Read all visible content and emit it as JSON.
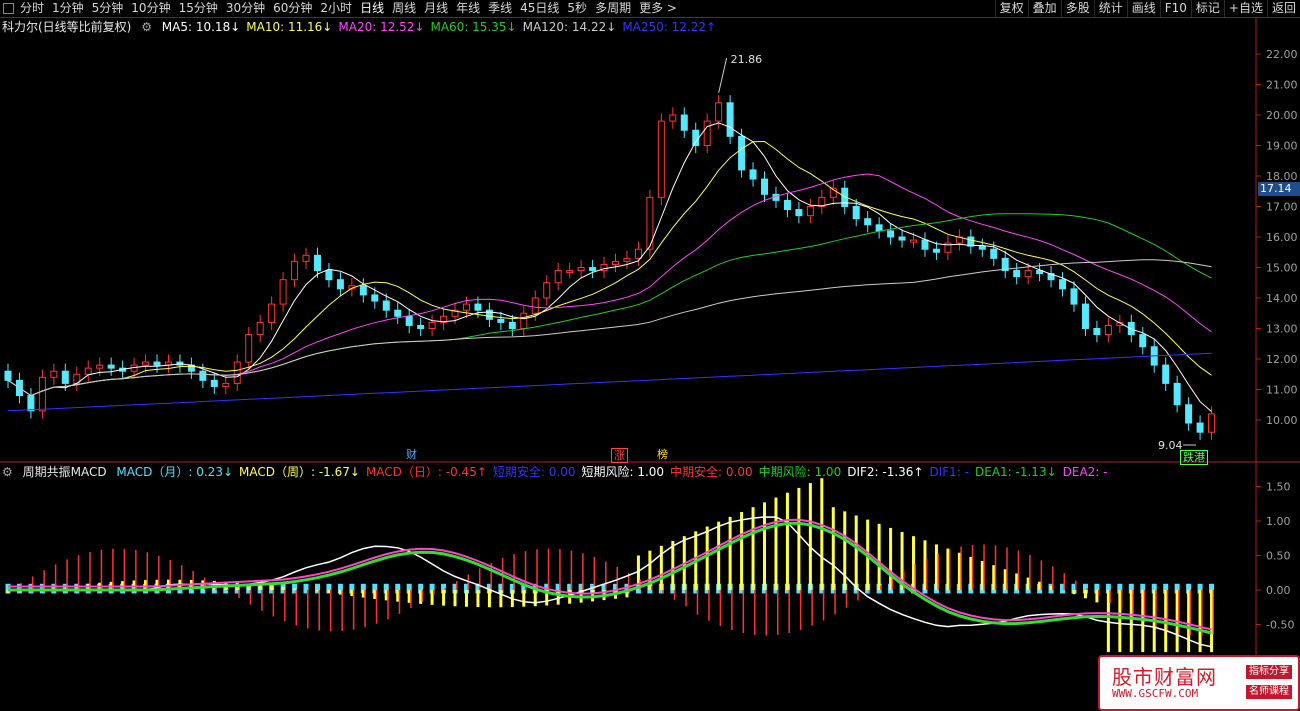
{
  "toolbar": {
    "periods": [
      "分时",
      "1分钟",
      "5分钟",
      "10分钟",
      "15分钟",
      "30分钟",
      "60分钟",
      "2小时",
      "日线",
      "周线",
      "月线",
      "年线",
      "季线",
      "45日线",
      "5秒",
      "多周期",
      "更多 >"
    ],
    "active_period": "日线",
    "actions": [
      "复权",
      "叠加",
      "多股",
      "统计",
      "画线",
      "F10",
      "标记",
      "+自选",
      "返回"
    ]
  },
  "main_legend": {
    "title": "科力尔(日线等比前复权)",
    "ma": [
      {
        "label": "MA5: 10.18↓",
        "color": "#ffffff"
      },
      {
        "label": "MA10: 11.16↓",
        "color": "#ffff55"
      },
      {
        "label": "MA20: 12.52↓",
        "color": "#ff44ff"
      },
      {
        "label": "MA60: 15.35↓",
        "color": "#22cc22"
      },
      {
        "label": "MA120: 14.22↓",
        "color": "#cccccc"
      },
      {
        "label": "MA250: 12.22↑",
        "color": "#3333ff"
      }
    ]
  },
  "sub_legend": {
    "title": "周期共振MACD",
    "items": [
      {
        "label": "MACD（月）: 0.23↓",
        "color": "#55e0ff"
      },
      {
        "label": "MACD（周）: -1.67↓",
        "color": "#ffff55"
      },
      {
        "label": "MACD（日）: -0.45↑",
        "color": "#ff3333"
      },
      {
        "label": "短期安全: 0.00",
        "color": "#3333ff"
      },
      {
        "label": "短期风险: 1.00",
        "color": "#ffffff"
      },
      {
        "label": "中期安全: 0.00",
        "color": "#ff3333"
      },
      {
        "label": "中期风险: 1.00",
        "color": "#22cc22"
      },
      {
        "label": "DIF2: -1.36↑",
        "color": "#ffffff"
      },
      {
        "label": "DIF1: -",
        "color": "#3333ff"
      },
      {
        "label": "DEA1: -1.13↓",
        "color": "#22cc22"
      },
      {
        "label": "DEA2: -",
        "color": "#ff44ff"
      }
    ]
  },
  "price_axis": [
    "22.00",
    "21.00",
    "20.00",
    "19.00",
    "18.00",
    "17.00",
    "16.00",
    "15.00",
    "14.00",
    "13.00",
    "12.00",
    "11.00",
    "10.00"
  ],
  "current_price_tag": "17.14",
  "macd_axis": [
    "1.50",
    "1.00",
    "0.50",
    "0.00",
    "-0.50"
  ],
  "annotations": {
    "high": "21.86",
    "low": "9.04",
    "markers": [
      {
        "text": "财",
        "color": "#55aaff"
      },
      {
        "text": "涨",
        "color": "#ff4444"
      },
      {
        "text": "榜",
        "color": "#ffdd44"
      },
      {
        "text": "跌港",
        "color": "#55ff55"
      }
    ]
  },
  "watermark": {
    "title": "股市财富网",
    "url": "WWW.GSCFW.COM",
    "tag1": "指标分享",
    "tag2": "名师课程"
  },
  "colors": {
    "up": "#ff3333",
    "down": "#55e8ff",
    "ma5": "#ffffff",
    "ma10": "#ffff55",
    "ma20": "#ff44ff",
    "ma60": "#22cc22",
    "ma120": "#cccccc",
    "ma250": "#3333ff"
  }
}
